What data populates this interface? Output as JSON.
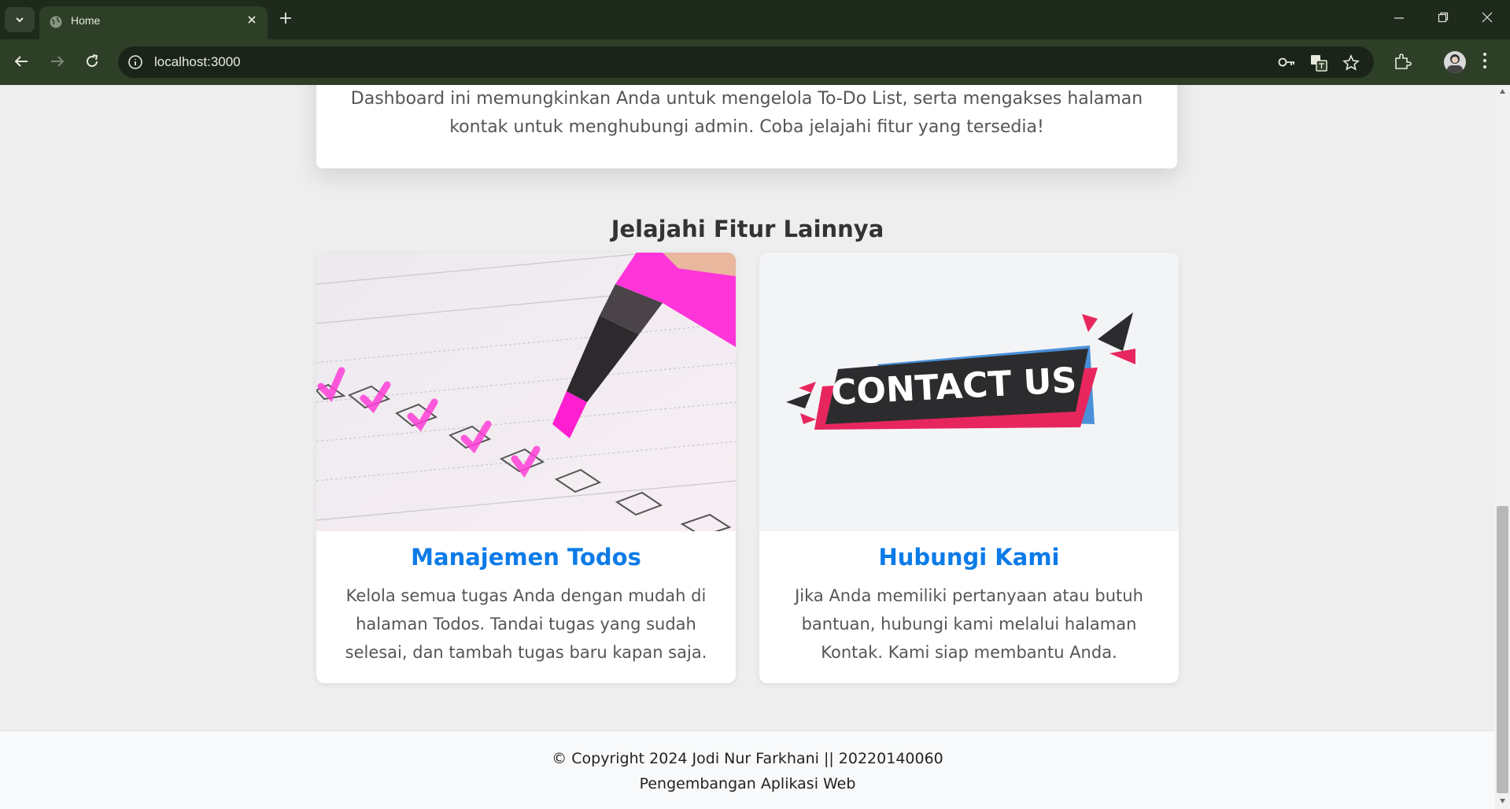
{
  "browser": {
    "tab_title": "Home",
    "url": "localhost:3000"
  },
  "intro": {
    "text": "Dashboard ini memungkinkan Anda untuk mengelola To-Do List, serta mengakses halaman kontak untuk menghubungi admin. Coba jelajahi fitur yang tersedia!"
  },
  "features": {
    "title": "Jelajahi Fitur Lainnya",
    "cards": [
      {
        "title": "Manajemen Todos",
        "description": "Kelola semua tugas Anda dengan mudah di halaman Todos. Tandai tugas yang sudah selesai, dan tambah tugas baru kapan saja.",
        "image_icon": "checklist-highlighter-image"
      },
      {
        "title": "Hubungi Kami",
        "description": "Jika Anda memiliki pertanyaan atau butuh bantuan, hubungi kami melalui halaman Kontak. Kami siap membantu Anda.",
        "image_text": "CONTACT US"
      }
    ]
  },
  "footer": {
    "copyright": "© Copyright 2024 Jodi Nur Farkhani || 20220140060",
    "subtitle": "Pengembangan Aplikasi Web"
  },
  "colors": {
    "chrome_dark": "#1e2a1c",
    "chrome_toolbar": "#2e3f28",
    "accent_link": "#0b7be8",
    "highlighter_pink": "#ff2bd6",
    "contact_red": "#e8265e",
    "contact_blue": "#4a90d9"
  }
}
